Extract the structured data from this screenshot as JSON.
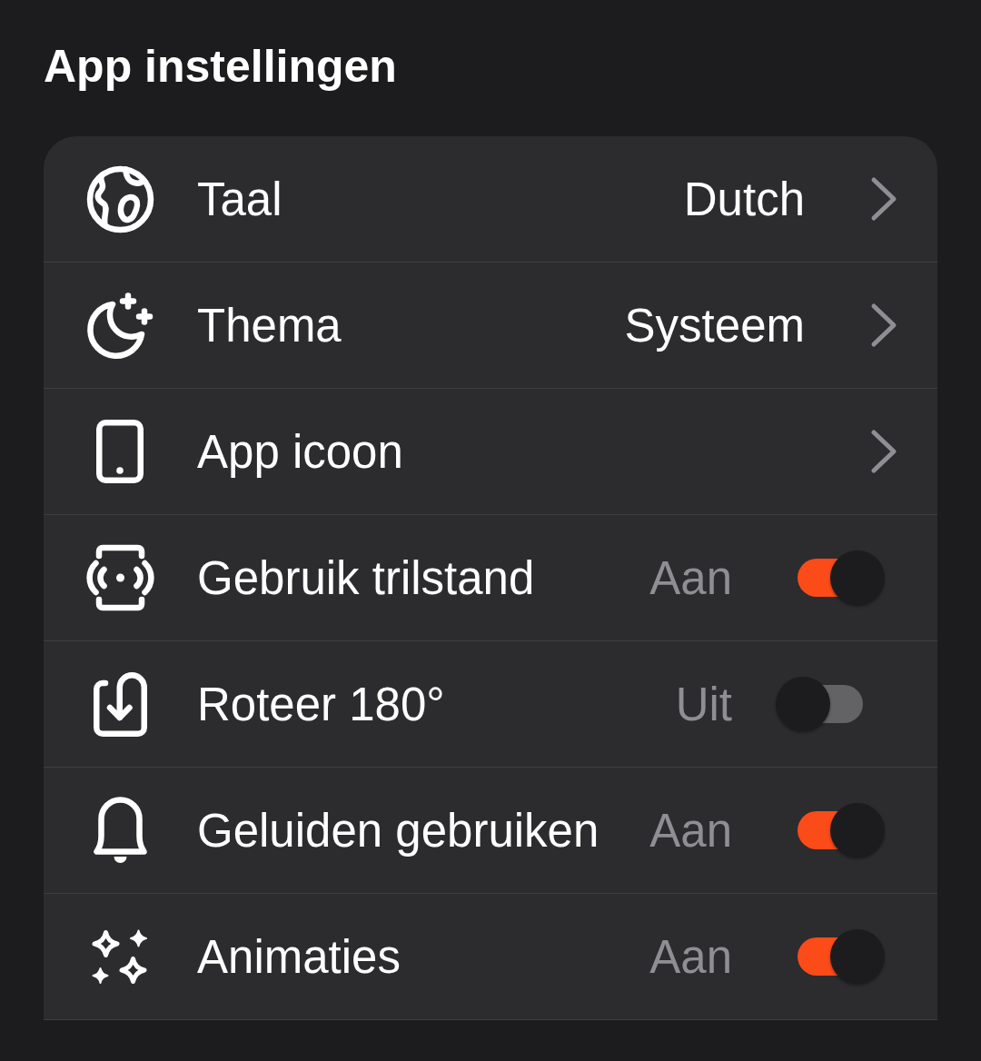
{
  "title": "App instellingen",
  "settings": [
    {
      "kind": "link",
      "label": "Taal",
      "value": "Dutch"
    },
    {
      "kind": "link",
      "label": "Thema",
      "value": "Systeem"
    },
    {
      "kind": "link",
      "label": "App icoon"
    },
    {
      "kind": "toggle",
      "label": "Gebruik trilstand",
      "value": "Aan",
      "on": true
    },
    {
      "kind": "toggle",
      "label": "Roteer 180°",
      "value": "Uit",
      "on": false
    },
    {
      "kind": "toggle",
      "label": "Geluiden gebruiken",
      "value": "Aan",
      "on": true
    },
    {
      "kind": "toggle",
      "label": "Animaties",
      "value": "Aan",
      "on": true
    }
  ]
}
